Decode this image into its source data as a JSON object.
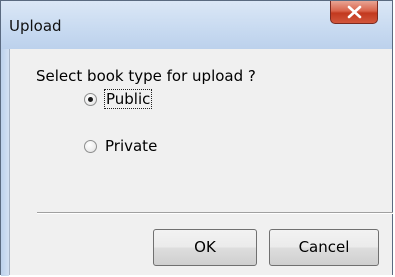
{
  "window": {
    "title": "Upload"
  },
  "dialog": {
    "question": "Select book type for upload ?",
    "options": [
      {
        "label": "Public",
        "selected": true
      },
      {
        "label": "Private",
        "selected": false
      }
    ],
    "buttons": {
      "ok_label": "OK",
      "cancel_label": "Cancel"
    }
  },
  "colors": {
    "titlebar": "#c9dbf1",
    "close_button": "#c2391f",
    "dialog_background": "#f0f0f0"
  },
  "icons": {
    "close": "close-icon",
    "radio": "radio-button-icon"
  }
}
